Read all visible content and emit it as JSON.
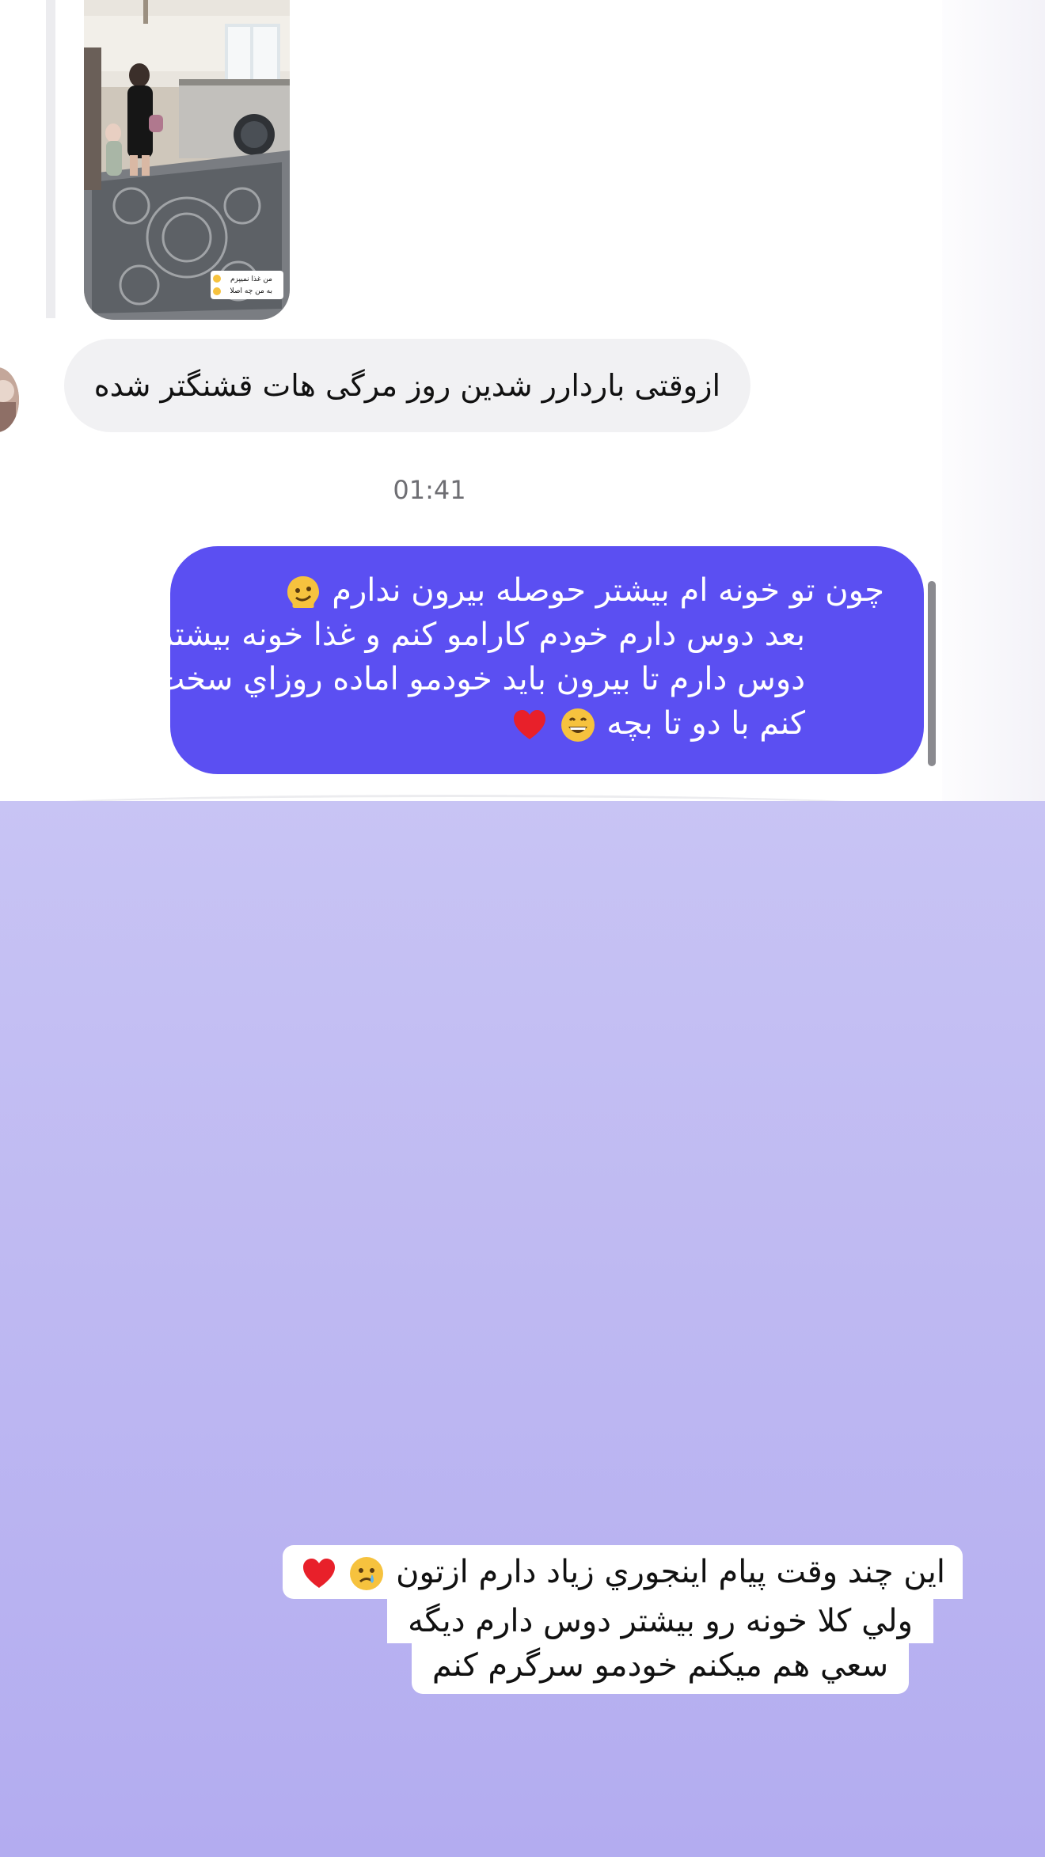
{
  "conversation": {
    "received_message": {
      "text": "ازوقتی باردارر شدین روز مرگی هات  قشنگتر شده"
    },
    "timestamp": "01:41",
    "sent_message": {
      "lines": [
        "چون تو خونه ام بیشتر حوصله بیرون ندارم",
        "بعد دوس دارم خودم کارامو کنم و غذا خونه بیشتر",
        "دوس دارم تا بیرون باید خودمو اماده روزاي سخت تر",
        "کنم با دو تا بچه"
      ],
      "emojis": [
        "melting-face",
        "grinning-face",
        "red-heart"
      ]
    }
  },
  "shared_image": {
    "caption": "من غذا نمیپزم\nبه من چه اصلا"
  },
  "story_overlay": {
    "lines": [
      "اين چند وقت پيام اينجوري زياد دارم ازتون",
      "ولي کلا خونه رو بیشتر دوس دارم دیگه",
      "سعي هم ميکنم خودمو سرگرم کنم"
    ],
    "emojis": [
      "crying-face",
      "red-heart"
    ]
  },
  "colors": {
    "sent_bubble": "#5b4ff2",
    "received_bubble": "#f1f1f3",
    "background_top": "#dcdaf6",
    "background_bottom": "#b3acf0"
  }
}
